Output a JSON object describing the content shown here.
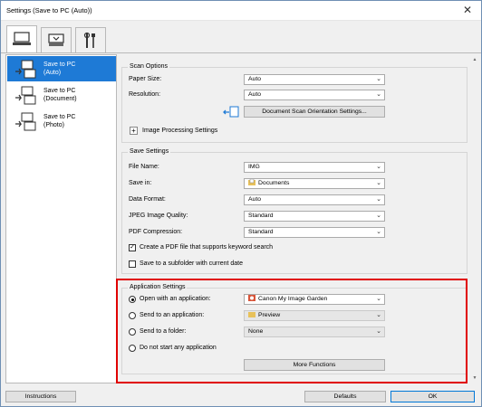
{
  "window": {
    "title": "Settings (Save to PC (Auto))",
    "close_glyph": "✕"
  },
  "tabs": [
    {
      "icon": "scan-from-computer-icon"
    },
    {
      "icon": "scan-from-panel-icon"
    },
    {
      "icon": "general-settings-tools-icon"
    }
  ],
  "sidebar": {
    "items": [
      {
        "label_line1": "Save to PC",
        "label_line2": "(Auto)",
        "active": true
      },
      {
        "label_line1": "Save to PC",
        "label_line2": "(Document)",
        "active": false
      },
      {
        "label_line1": "Save to PC",
        "label_line2": "(Photo)",
        "active": false
      }
    ]
  },
  "scan_options": {
    "title": "Scan Options",
    "paper_size_label": "Paper Size:",
    "paper_size_value": "Auto",
    "resolution_label": "Resolution:",
    "resolution_value": "Auto",
    "orientation_button": "Document Scan Orientation Settings...",
    "image_processing_label": "Image Processing Settings",
    "expand_glyph": "+"
  },
  "save_settings": {
    "title": "Save Settings",
    "file_name_label": "File Name:",
    "file_name_value": "IMG",
    "save_in_label": "Save in:",
    "save_in_value": "Documents",
    "data_format_label": "Data Format:",
    "data_format_value": "Auto",
    "jpeg_quality_label": "JPEG Image Quality:",
    "jpeg_quality_value": "Standard",
    "pdf_compression_label": "PDF Compression:",
    "pdf_compression_value": "Standard",
    "keyword_pdf_label": "Create a PDF file that supports keyword search",
    "keyword_pdf_checked": true,
    "subfolder_label": "Save to a subfolder with current date",
    "subfolder_checked": false,
    "check_glyph": "✓"
  },
  "application_settings": {
    "title": "Application Settings",
    "open_with_label": "Open with an application:",
    "open_with_value": "Canon My Image Garden",
    "send_app_label": "Send to an application:",
    "send_app_value": "Preview",
    "send_folder_label": "Send to a folder:",
    "send_folder_value": "None",
    "do_not_start_label": "Do not start any application",
    "more_functions_button": "More Functions",
    "selected_option": "open_with"
  },
  "footer": {
    "instructions_button": "Instructions",
    "defaults_button": "Defaults",
    "ok_button": "OK"
  },
  "colors": {
    "accent": "#1e7ad6",
    "highlight_border": "#e00000"
  },
  "dropdown_glyph": "⌄"
}
